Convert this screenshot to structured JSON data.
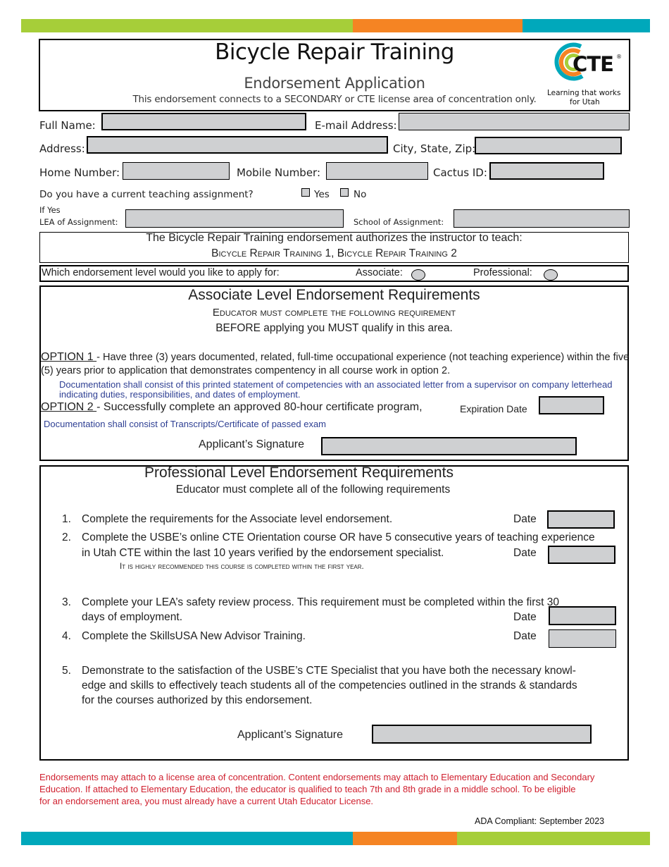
{
  "colors": {
    "green": "#a6ce39",
    "orange": "#f58423",
    "teal": "#00a8bb",
    "field_fill": "#cfd0d2",
    "note_blue": "#2e3f93",
    "footer_red": "#d0202f"
  },
  "header": {
    "title": "Bicycle Repair Training",
    "subtitle": "Endorsement Application",
    "note": "This endorsement connects to a SECONDARY or CTE license area of concentration only.",
    "logo": {
      "icon": "cte-logo-icon",
      "text": "CTE",
      "registered": "®",
      "tagline_1": "Learning that works",
      "tagline_2": "for Utah"
    }
  },
  "personal": {
    "full_name_label": "Full Name:",
    "full_name_value": "",
    "email_label": "E-mail Address:",
    "email_value": "",
    "address_label": "Address:",
    "address_value": "",
    "city_label": "City, State, Zip:",
    "city_value": "",
    "home_label": "Home Number:",
    "home_value": "",
    "mobile_label": "Mobile Number:",
    "mobile_value": "",
    "cactus_label": "Cactus ID:",
    "cactus_value": "",
    "teaching_question": "Do you have a current teaching assignment?",
    "yes_label": "Yes",
    "no_label": "No",
    "if_yes": "If Yes",
    "lea_label": "LEA of Assignment:",
    "lea_value": "",
    "school_label": "School of Assignment:",
    "school_value": ""
  },
  "authorizes": {
    "line1": "The Bicycle Repair Training endorsement authorizes the instructor to teach:",
    "courses": "Bicycle Repair Training 1, Bicycle Repair Training 2"
  },
  "level": {
    "question": "Which endorsement level would you like to apply for:",
    "associate_label": "Associate:",
    "professional_label": "Professional:"
  },
  "associate": {
    "title": "Associate Level Endorsement Requirements",
    "subtitle": "Educator must complete the following requirement",
    "before": "BEFORE applying you MUST qualify in this area.",
    "option1_label": "OPTION 1 ",
    "option1_text": "- Have three (3) years documented, related, full-time occupational experience (not teaching experience) within the five (5) years prior to application that demonstrates compentency in all course work in option 2.",
    "option1_doc": "Documentation shall consist of this printed statement of competencies with an associated letter from a supervisor on company letterhead indicating duties, responsibilities, and dates of employment.",
    "option2_label": "OPTION 2 ",
    "option2_text": "-  Successfully complete an approved 80-hour certificate program,",
    "expiration_label": "Expiration Date",
    "expiration_value": "",
    "option2_doc": "Documentation shall consist of Transcripts/Certificate of passed exam",
    "signature_label": "Applicant’s Signature",
    "signature_value": ""
  },
  "professional": {
    "title": "Professional Level Endorsement Requirements",
    "subtitle": "Educator must complete all of the following requirements",
    "items": [
      {
        "num": "1.",
        "text": "Complete the requirements for the Associate level endorsement.",
        "date_label": "Date",
        "date_value": ""
      },
      {
        "num": "2.",
        "text_1": "Complete the USBE’s online CTE Orientation course OR have 5 consecutive years of teaching experience",
        "text_2": "in Utah CTE within the last 10 years verified by the endorsement specialist.",
        "note": "It is highly recommended this course is completed within the first year.",
        "date_label": "Date",
        "date_value": ""
      },
      {
        "num": "3.",
        "text_1": "Complete your LEA’s safety review process. This requirement must be completed within the first 30",
        "text_2": "days of employment.",
        "date_label": "Date",
        "date_value": ""
      },
      {
        "num": "4.",
        "text": "Complete the SkillsUSA New Advisor Training.",
        "date_label": "Date",
        "date_value": ""
      },
      {
        "num": "5.",
        "text_1": "Demonstrate to the satisfaction of the USBE’s CTE Specialist that you have both the necessary knowl-",
        "text_2": "edge and skills to effectively teach students all of the competencies outlined in the strands & standards",
        "text_3": "for the courses authorized by this endorsement."
      }
    ],
    "signature_label": "Applicant’s Signature",
    "signature_value": ""
  },
  "footer": {
    "note_1": "Endorsements may attach to a license area of concentration. Content endorsements may attach to Elementary Education and Secondary",
    "note_2": "Education. If attached to Elementary Education,  the educator is qualified to teach 7th and 8th grade in a middle school. To be eligible",
    "note_3": "for an endorsement area, you must already have a current Utah Educator License.",
    "ada": "ADA  Compliant: September 2023"
  }
}
